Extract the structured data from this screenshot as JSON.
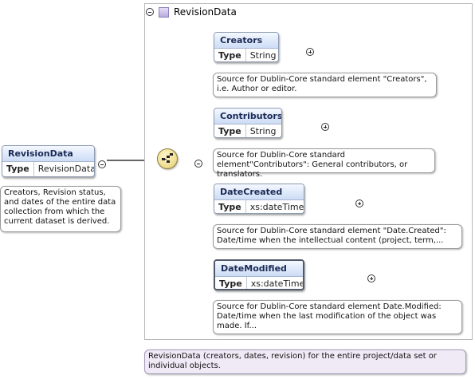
{
  "root": {
    "name": "RevisionData",
    "type_label": "Type",
    "type_value": "RevisionData",
    "doc": "Creators, Revision status, and dates of the entire data collection from which the current dataset is derived."
  },
  "complex_type": {
    "name": "RevisionData",
    "doc": "RevisionData (creators, dates, revision) for the entire project/data set or individual objects."
  },
  "children": [
    {
      "name": "Creators",
      "type_label": "Type",
      "type_value": "String",
      "doc": "Source for Dublin-Core standard element \"Creators\", i.e. Author or editor."
    },
    {
      "name": "Contributors",
      "type_label": "Type",
      "type_value": "String",
      "doc": "Source for Dublin-Core standard element\"Contributors\": General contributors, or translators."
    },
    {
      "name": "DateCreated",
      "type_label": "Type",
      "type_value": "xs:dateTime",
      "doc": "Source for Dublin-Core standard element \"Date.Created\": Date/time when the intellectual content (project, term,..."
    },
    {
      "name": "DateModified",
      "type_label": "Type",
      "type_value": "xs:dateTime",
      "doc": "Source for Dublin-Core standard element Date.Modified: Date/time when the last modification of the object was made. If..."
    }
  ],
  "colors": {
    "element_header": "#cddcf5",
    "compositor": "#e4cf75",
    "complex_type_doc_bg": "#efeaf6"
  },
  "icons": {
    "collapse": "minus-circle-icon",
    "expand": "plus-circle-icon",
    "complex_type": "complex-type-icon",
    "sequence": "sequence-compositor-icon"
  }
}
